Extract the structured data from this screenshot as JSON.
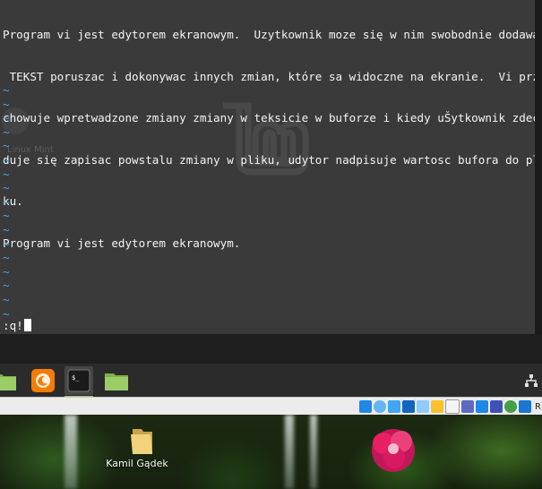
{
  "terminal": {
    "lines": [
      "Program vi jest edytorem ekranowym.  Uzytkownik moze się w nim swobodnie dodawac",
      " TEKST poruszac i dokonywac innych zmian, które sa widoczne na ekranie.  Vi prze",
      "chowuje wpretwadzone zmiany zmiany w teksicie w buforze i kiedy uŠytkownik zdecy",
      "duje się zapisac powstalu zmiany w pliku, udytor nadpisuje wartosc bufora do pli",
      "ku.",
      "Program vi jest edytorem ekranowym."
    ],
    "empty_line_marker": "~",
    "empty_line_count": 17,
    "command": ":q!",
    "background_label": "Linux Mint"
  },
  "panel": {
    "items": [
      {
        "name": "folder",
        "icon": "folder-icon"
      },
      {
        "name": "firefox",
        "icon": "firefox-icon"
      },
      {
        "name": "terminal",
        "icon": "terminal-icon",
        "label": "$_",
        "active": true
      },
      {
        "name": "files",
        "icon": "folder-icon"
      }
    ],
    "network_icon": "network-icon"
  },
  "vbox_status": {
    "icons": [
      "hard-disk-icon",
      "optical-disk-icon",
      "audio-icon",
      "network-adapter-icon",
      "usb-icon",
      "shared-folders-icon",
      "display-icon",
      "video-capture-icon",
      "mouse-integration-icon",
      "vrde-icon",
      "green-arrow-icon",
      "down-arrow-icon"
    ],
    "host_key_text": "Rig"
  },
  "desktop": {
    "icons": [
      {
        "label": "Kamil Gądek",
        "icon": "folder-icon"
      }
    ]
  },
  "colors": {
    "terminal_bg": "#3a3a3a",
    "tilde": "#4aa3df",
    "panel_bg": "#2b2b2b",
    "mint_green": "#8bc34a"
  }
}
